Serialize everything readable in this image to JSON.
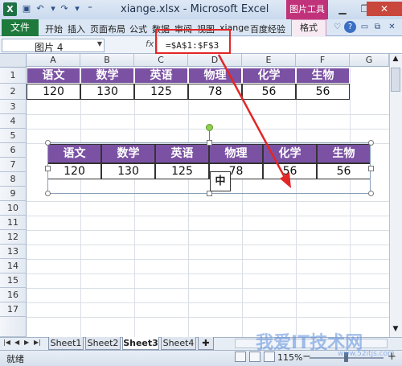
{
  "window": {
    "title": "xiange.xlsx - Microsoft Excel",
    "contextual_tab": "图片工具",
    "app_icon": "X"
  },
  "ribbon": {
    "file_tab": "文件",
    "tabs": [
      "开始",
      "插入",
      "页面布局",
      "公式",
      "数据",
      "审阅",
      "视图",
      "xiange",
      "百度经验"
    ],
    "contextual_tabs": [
      "格式"
    ]
  },
  "formula_bar": {
    "name_box": "图片 4",
    "fx": "fx",
    "formula": "=$A$1:$F$3"
  },
  "grid": {
    "columns": [
      "A",
      "B",
      "C",
      "D",
      "E",
      "F",
      "G"
    ],
    "rows": [
      "1",
      "2",
      "3",
      "4",
      "5",
      "6",
      "7",
      "8",
      "9",
      "10",
      "11",
      "12",
      "13",
      "14",
      "15",
      "16",
      "17"
    ]
  },
  "table": {
    "headers": [
      "语文",
      "数学",
      "英语",
      "物理",
      "化学",
      "生物"
    ],
    "values": [
      "120",
      "130",
      "125",
      "78",
      "56",
      "56"
    ]
  },
  "picture": {
    "headers": [
      "语文",
      "数学",
      "英语",
      "物理",
      "化学",
      "生物"
    ],
    "values": [
      "120",
      "130",
      "125",
      "78",
      "56",
      "56"
    ],
    "ime_char": "中"
  },
  "sheets": {
    "tabs": [
      "Sheet1",
      "Sheet2",
      "Sheet3",
      "Sheet4"
    ],
    "active": "Sheet3"
  },
  "status": {
    "text": "就绪",
    "zoom": "115%"
  },
  "watermark": {
    "text": "我爱IT技术网",
    "url": "www.52itjs.com"
  },
  "colors": {
    "header_purple": "#7b52a3",
    "annotation_red": "#e32626",
    "file_tab_green": "#1e7a3c",
    "contextual_pink": "#c0337b"
  }
}
